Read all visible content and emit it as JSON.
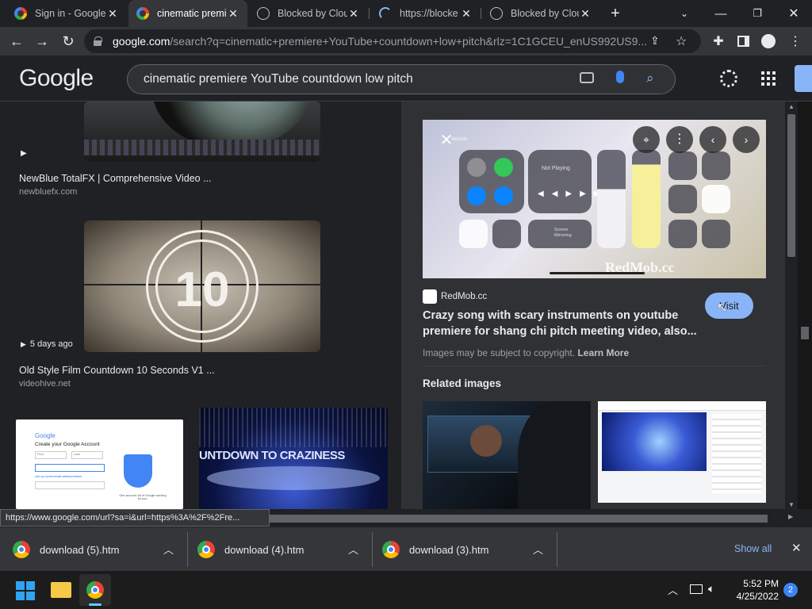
{
  "browser": {
    "tabs": [
      {
        "title": "Sign in - Google",
        "icon": "google-icon",
        "active": false
      },
      {
        "title": "cinematic premiere",
        "icon": "google-icon",
        "active": true
      },
      {
        "title": "Blocked by Clou",
        "icon": "globe-icon",
        "active": false
      },
      {
        "title": "https://blocke",
        "icon": "loading-icon",
        "active": false
      },
      {
        "title": "Blocked by Clou",
        "icon": "globe-icon",
        "active": false
      }
    ],
    "new_tab": "+",
    "url_host": "google.com",
    "url_rest": "/search?q=cinematic+premiere+YouTube+countdown+low+pitch&rlz=1C1GCEU_enUS992US9..."
  },
  "google": {
    "logo": "Google",
    "query": "cinematic premiere YouTube countdown low pitch"
  },
  "results": [
    {
      "title": "NewBlue TotalFX | Comprehensive Video ...",
      "site": "newbluefx.com",
      "badge": ""
    },
    {
      "title": "Old Style Film Countdown 10 Seconds V1 ...",
      "site": "videohive.net",
      "badge": "5 days ago",
      "countdown": "10"
    }
  ],
  "bottom_thumbs": {
    "account_card": {
      "logo": "Google",
      "heading": "Create your Google Account",
      "fields": [
        "First",
        "Last"
      ],
      "link_text": "Use my current email address instead",
      "side_text": "One account. All of Google working for you."
    },
    "banner_text": "UNTDOWN TO CRAZINESS"
  },
  "panel": {
    "carrier": "Verizon",
    "cc_now_playing": "Not Playing",
    "cc_screen_mirroring": "Screen Mirroring",
    "watermark": "RedMob.cc",
    "source": "RedMob.cc",
    "title": "Crazy song with scary instruments on youtube premiere for shang chi pitch meeting video, also...",
    "visit_label": "Visit",
    "copyright": "Images may be subject to copyright.",
    "learn_more": "Learn More",
    "related_heading": "Related images"
  },
  "status_url": "https://www.google.com/url?sa=i&url=https%3A%2F%2Fre...",
  "downloads": [
    {
      "name": "download (5).htm"
    },
    {
      "name": "download (4).htm"
    },
    {
      "name": "download (3).htm"
    }
  ],
  "show_all": "Show all",
  "taskbar": {
    "time": "5:52 PM",
    "date": "4/25/2022",
    "notifications": "2"
  },
  "colors": {
    "accent": "#8ab4f8",
    "visit_bg": "#8ab4f8",
    "dark_bg": "#202124",
    "panel_bg": "#303134"
  }
}
